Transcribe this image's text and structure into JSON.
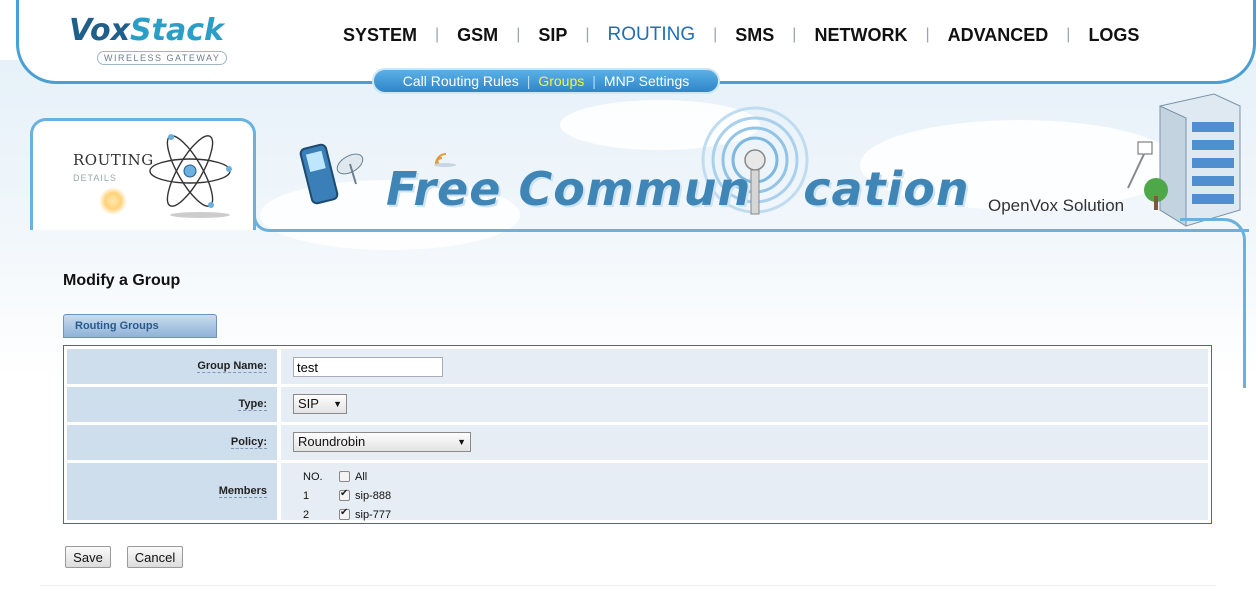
{
  "brand": {
    "name_part1": "Vox",
    "name_part2": "Stack",
    "tagline": "WIRELESS GATEWAY",
    "accent": "#4a9fd4"
  },
  "nav": {
    "items": [
      {
        "label": "SYSTEM"
      },
      {
        "label": "GSM"
      },
      {
        "label": "SIP"
      },
      {
        "label": "ROUTING",
        "active": true
      },
      {
        "label": "SMS"
      },
      {
        "label": "NETWORK"
      },
      {
        "label": "ADVANCED"
      },
      {
        "label": "LOGS"
      }
    ],
    "active_color": "#1e6fb8"
  },
  "subnav": {
    "items": [
      {
        "label": "Call Routing Rules"
      },
      {
        "label": "Groups",
        "active": true
      },
      {
        "label": "MNP Settings"
      }
    ],
    "active_color": "#f6f241"
  },
  "panel": {
    "title": "ROUTING",
    "subtitle": "DETAILS"
  },
  "banner": {
    "text_left": "Free Commun",
    "text_right": "cation",
    "solution": "OpenVox Solution"
  },
  "page": {
    "title": "Modify a Group",
    "tab_label": "Routing Groups"
  },
  "form": {
    "group_name_label": "Group Name:",
    "group_name_value": "test",
    "type_label": "Type:",
    "type_value": "SIP",
    "policy_label": "Policy:",
    "policy_value": "Roundrobin",
    "members_label": "Members",
    "members_no_header": "NO.",
    "members_all_label": "All",
    "members_all_checked": false,
    "members": [
      {
        "no": "1",
        "name": "sip-888",
        "checked": true
      },
      {
        "no": "2",
        "name": "sip-777",
        "checked": true
      }
    ]
  },
  "actions": {
    "save_label": "Save",
    "cancel_label": "Cancel"
  }
}
